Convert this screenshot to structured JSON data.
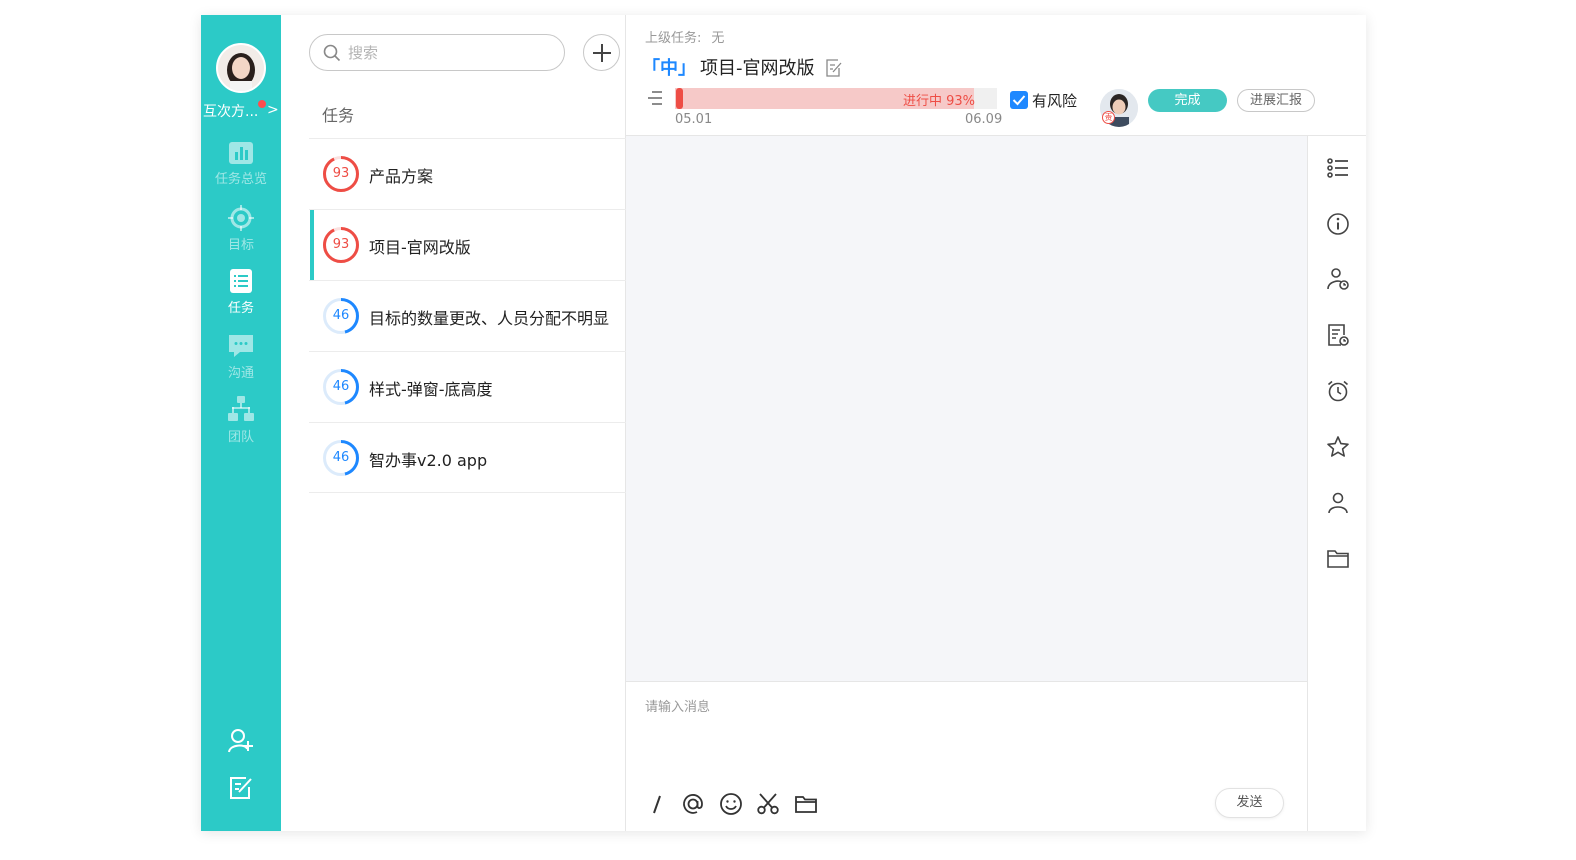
{
  "sidebar": {
    "user_name": "互次方...",
    "user_chevron": ">",
    "nav": [
      {
        "label": "任务总览",
        "icon": "bar-chart-icon",
        "active": false
      },
      {
        "label": "目标",
        "icon": "target-icon",
        "active": false
      },
      {
        "label": "任务",
        "icon": "list-icon",
        "active": true
      },
      {
        "label": "沟通",
        "icon": "chat-icon",
        "active": false
      },
      {
        "label": "团队",
        "icon": "org-chart-icon",
        "active": false
      }
    ],
    "bottom_icons": [
      "add-user-icon",
      "edit-note-icon"
    ]
  },
  "task_list": {
    "search_placeholder": "搜索",
    "section_title": "任务",
    "items": [
      {
        "name": "产品方案",
        "progress": 93,
        "selected": false
      },
      {
        "name": "项目-官网改版",
        "progress": 93,
        "selected": true
      },
      {
        "name": "目标的数量更改、人员分配不明显",
        "progress": 46,
        "selected": false
      },
      {
        "name": "样式-弹窗-底高度",
        "progress": 46,
        "selected": false
      },
      {
        "name": "智办事v2.0 app",
        "progress": 46,
        "selected": false
      }
    ]
  },
  "detail": {
    "parent_label": "上级任务:",
    "parent_value": "无",
    "priority": "「中」",
    "title": "项目-官网改版",
    "progress_text": "进行中 93%",
    "progress": 0.93,
    "start_date": "05.01",
    "end_date": "06.09",
    "risk_label": "有风险",
    "risk_checked": true,
    "owner_badge": "责",
    "done_label": "完成",
    "report_label": "进展汇报"
  },
  "composer": {
    "placeholder": "请输入消息",
    "tools": [
      "slash-icon",
      "at-icon",
      "emoji-icon",
      "scissors-icon",
      "folder-icon"
    ],
    "send_label": "发送"
  },
  "right_rail": [
    "checklist-icon",
    "info-icon",
    "user-clock-icon",
    "doc-clock-icon",
    "alarm-icon",
    "star-icon",
    "person-icon",
    "folder-icon"
  ],
  "colors": {
    "sidebar": "#2ccac7",
    "accent_blue": "#1e88ff",
    "danger": "#ee4d45",
    "progress_high": "#ee4d45",
    "progress_mid": "#1e88ff",
    "done_button": "#45c9c3"
  }
}
